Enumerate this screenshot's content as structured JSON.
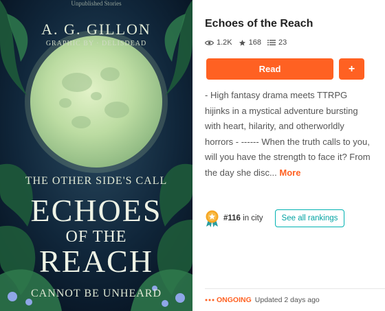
{
  "cover": {
    "top_text": "Unpublished Stories",
    "author": "A. G. GILLON",
    "graphic_by": "GRAPHIC BY · DELISDEAD",
    "subtitle": "THE OTHER SIDE'S CALL",
    "title_line1": "ECHOES",
    "title_line2": "OF THE",
    "title_line3": "REACH",
    "tagline": "CANNOT BE UNHEARD"
  },
  "story": {
    "title": "Echoes of the Reach",
    "reads": "1.2K",
    "votes": "168",
    "parts": "23",
    "read_label": "Read",
    "add_label": "+",
    "description": "- High fantasy drama meets TTRPG hijinks in a mystical adventure bursting with heart, hilarity, and otherworldly horrors - ------ When the truth calls to you, will you have the strength to face it? From the day she disc...",
    "more_label": "More",
    "rank_number": "#116",
    "rank_suffix": " in city",
    "see_rankings_label": "See all rankings",
    "status": "ONGOING",
    "updated": "Updated 2 days ago"
  },
  "icons": {
    "reads": "eye-icon",
    "votes": "star-icon",
    "parts": "list-icon",
    "rank": "ranking-medal-icon",
    "status": "ongoing-dots-icon"
  },
  "colors": {
    "accent": "#ff6122",
    "teal": "#00b2b2",
    "text": "#222222"
  }
}
